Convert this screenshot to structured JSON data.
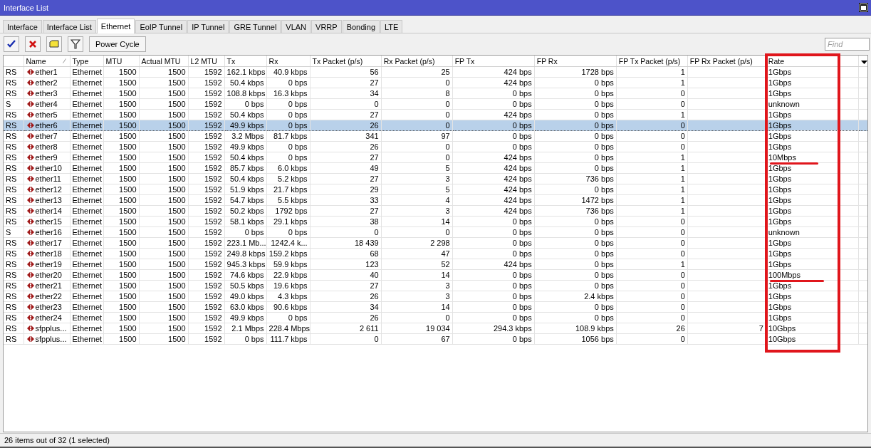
{
  "window": {
    "title": "Interface List"
  },
  "tabs": [
    {
      "label": "Interface",
      "selected": false
    },
    {
      "label": "Interface List",
      "selected": false
    },
    {
      "label": "Ethernet",
      "selected": true
    },
    {
      "label": "EoIP Tunnel",
      "selected": false
    },
    {
      "label": "IP Tunnel",
      "selected": false
    },
    {
      "label": "GRE Tunnel",
      "selected": false
    },
    {
      "label": "VLAN",
      "selected": false
    },
    {
      "label": "VRRP",
      "selected": false
    },
    {
      "label": "Bonding",
      "selected": false
    },
    {
      "label": "LTE",
      "selected": false
    }
  ],
  "toolbar": {
    "tools": [
      {
        "kind": "enable"
      },
      {
        "kind": "disable"
      },
      {
        "kind": "comment"
      },
      {
        "kind": "filter"
      }
    ],
    "button": "Power Cycle",
    "search": {
      "placeholder": "Find"
    }
  },
  "table": {
    "columns": [
      {
        "kind": "text"
      },
      {
        "label": "Name",
        "kind": "text",
        "sorted": true
      },
      {
        "label": "Type",
        "kind": "text"
      },
      {
        "label": "MTU",
        "kind": "number"
      },
      {
        "label": "Actual MTU",
        "kind": "number"
      },
      {
        "label": "L2 MTU",
        "kind": "number"
      },
      {
        "label": "Tx",
        "kind": "number"
      },
      {
        "label": "Rx",
        "kind": "number"
      },
      {
        "label": "Tx Packet (p/s)",
        "kind": "number"
      },
      {
        "label": "Rx Packet (p/s)",
        "kind": "number"
      },
      {
        "label": "FP Tx",
        "kind": "number"
      },
      {
        "label": "FP Rx",
        "kind": "number"
      },
      {
        "label": "FP Tx Packet (p/s)",
        "kind": "number"
      },
      {
        "label": "FP Rx Packet (p/s)",
        "kind": "number"
      },
      {
        "label": "Rate",
        "kind": "text",
        "highlighted": true
      }
    ],
    "rows": [
      {
        "selected": false,
        "underlined": false,
        "cells": [
          "RS",
          "ether1",
          "Ethernet",
          "1500",
          "1500",
          "1592",
          "162.1 kbps",
          "40.9 kbps",
          "56",
          "25",
          "424 bps",
          "1728 bps",
          "1",
          "",
          "1Gbps"
        ]
      },
      {
        "selected": false,
        "underlined": false,
        "cells": [
          "RS",
          "ether2",
          "Ethernet",
          "1500",
          "1500",
          "1592",
          "50.4 kbps",
          "0 bps",
          "27",
          "0",
          "424 bps",
          "0 bps",
          "1",
          "",
          "1Gbps"
        ]
      },
      {
        "selected": false,
        "underlined": false,
        "cells": [
          "RS",
          "ether3",
          "Ethernet",
          "1500",
          "1500",
          "1592",
          "108.8 kbps",
          "16.3 kbps",
          "34",
          "8",
          "0 bps",
          "0 bps",
          "0",
          "",
          "1Gbps"
        ]
      },
      {
        "selected": false,
        "underlined": false,
        "cells": [
          "S",
          "ether4",
          "Ethernet",
          "1500",
          "1500",
          "1592",
          "0 bps",
          "0 bps",
          "0",
          "0",
          "0 bps",
          "0 bps",
          "0",
          "",
          "unknown"
        ]
      },
      {
        "selected": false,
        "underlined": false,
        "cells": [
          "RS",
          "ether5",
          "Ethernet",
          "1500",
          "1500",
          "1592",
          "50.4 kbps",
          "0 bps",
          "27",
          "0",
          "424 bps",
          "0 bps",
          "1",
          "",
          "1Gbps"
        ]
      },
      {
        "selected": true,
        "underlined": false,
        "cells": [
          "RS",
          "ether6",
          "Ethernet",
          "1500",
          "1500",
          "1592",
          "49.9 kbps",
          "0 bps",
          "26",
          "0",
          "0 bps",
          "0 bps",
          "0",
          "",
          "1Gbps"
        ]
      },
      {
        "selected": false,
        "underlined": false,
        "cells": [
          "RS",
          "ether7",
          "Ethernet",
          "1500",
          "1500",
          "1592",
          "3.2 Mbps",
          "81.7 kbps",
          "341",
          "97",
          "0 bps",
          "0 bps",
          "0",
          "",
          "1Gbps"
        ]
      },
      {
        "selected": false,
        "underlined": false,
        "cells": [
          "RS",
          "ether8",
          "Ethernet",
          "1500",
          "1500",
          "1592",
          "49.9 kbps",
          "0 bps",
          "26",
          "0",
          "0 bps",
          "0 bps",
          "0",
          "",
          "1Gbps"
        ]
      },
      {
        "selected": false,
        "underlined": true,
        "cells": [
          "RS",
          "ether9",
          "Ethernet",
          "1500",
          "1500",
          "1592",
          "50.4 kbps",
          "0 bps",
          "27",
          "0",
          "424 bps",
          "0 bps",
          "1",
          "",
          "10Mbps"
        ]
      },
      {
        "selected": false,
        "underlined": false,
        "cells": [
          "RS",
          "ether10",
          "Ethernet",
          "1500",
          "1500",
          "1592",
          "85.7 kbps",
          "6.0 kbps",
          "49",
          "5",
          "424 bps",
          "0 bps",
          "1",
          "",
          "1Gbps"
        ]
      },
      {
        "selected": false,
        "underlined": false,
        "cells": [
          "RS",
          "ether11",
          "Ethernet",
          "1500",
          "1500",
          "1592",
          "50.4 kbps",
          "5.2 kbps",
          "27",
          "3",
          "424 bps",
          "736 bps",
          "1",
          "",
          "1Gbps"
        ]
      },
      {
        "selected": false,
        "underlined": false,
        "cells": [
          "RS",
          "ether12",
          "Ethernet",
          "1500",
          "1500",
          "1592",
          "51.9 kbps",
          "21.7 kbps",
          "29",
          "5",
          "424 bps",
          "0 bps",
          "1",
          "",
          "1Gbps"
        ]
      },
      {
        "selected": false,
        "underlined": false,
        "cells": [
          "RS",
          "ether13",
          "Ethernet",
          "1500",
          "1500",
          "1592",
          "54.7 kbps",
          "5.5 kbps",
          "33",
          "4",
          "424 bps",
          "1472 bps",
          "1",
          "",
          "1Gbps"
        ]
      },
      {
        "selected": false,
        "underlined": false,
        "cells": [
          "RS",
          "ether14",
          "Ethernet",
          "1500",
          "1500",
          "1592",
          "50.2 kbps",
          "1792 bps",
          "27",
          "3",
          "424 bps",
          "736 bps",
          "1",
          "",
          "1Gbps"
        ]
      },
      {
        "selected": false,
        "underlined": false,
        "cells": [
          "RS",
          "ether15",
          "Ethernet",
          "1500",
          "1500",
          "1592",
          "58.1 kbps",
          "29.1 kbps",
          "38",
          "14",
          "0 bps",
          "0 bps",
          "0",
          "",
          "1Gbps"
        ]
      },
      {
        "selected": false,
        "underlined": false,
        "cells": [
          "S",
          "ether16",
          "Ethernet",
          "1500",
          "1500",
          "1592",
          "0 bps",
          "0 bps",
          "0",
          "0",
          "0 bps",
          "0 bps",
          "0",
          "",
          "unknown"
        ]
      },
      {
        "selected": false,
        "underlined": false,
        "cells": [
          "RS",
          "ether17",
          "Ethernet",
          "1500",
          "1500",
          "1592",
          "223.1 Mb...",
          "1242.4 k...",
          "18 439",
          "2 298",
          "0 bps",
          "0 bps",
          "0",
          "",
          "1Gbps"
        ]
      },
      {
        "selected": false,
        "underlined": false,
        "cells": [
          "RS",
          "ether18",
          "Ethernet",
          "1500",
          "1500",
          "1592",
          "249.8 kbps",
          "159.2 kbps",
          "68",
          "47",
          "0 bps",
          "0 bps",
          "0",
          "",
          "1Gbps"
        ]
      },
      {
        "selected": false,
        "underlined": false,
        "cells": [
          "RS",
          "ether19",
          "Ethernet",
          "1500",
          "1500",
          "1592",
          "945.3 kbps",
          "59.9 kbps",
          "123",
          "52",
          "424 bps",
          "0 bps",
          "1",
          "",
          "1Gbps"
        ]
      },
      {
        "selected": false,
        "underlined": true,
        "cells": [
          "RS",
          "ether20",
          "Ethernet",
          "1500",
          "1500",
          "1592",
          "74.6 kbps",
          "22.9 kbps",
          "40",
          "14",
          "0 bps",
          "0 bps",
          "0",
          "",
          "100Mbps"
        ]
      },
      {
        "selected": false,
        "underlined": false,
        "cells": [
          "RS",
          "ether21",
          "Ethernet",
          "1500",
          "1500",
          "1592",
          "50.5 kbps",
          "19.6 kbps",
          "27",
          "3",
          "0 bps",
          "0 bps",
          "0",
          "",
          "1Gbps"
        ]
      },
      {
        "selected": false,
        "underlined": false,
        "cells": [
          "RS",
          "ether22",
          "Ethernet",
          "1500",
          "1500",
          "1592",
          "49.0 kbps",
          "4.3 kbps",
          "26",
          "3",
          "0 bps",
          "2.4 kbps",
          "0",
          "",
          "1Gbps"
        ]
      },
      {
        "selected": false,
        "underlined": false,
        "cells": [
          "RS",
          "ether23",
          "Ethernet",
          "1500",
          "1500",
          "1592",
          "63.0 kbps",
          "90.6 kbps",
          "34",
          "14",
          "0 bps",
          "0 bps",
          "0",
          "",
          "1Gbps"
        ]
      },
      {
        "selected": false,
        "underlined": false,
        "cells": [
          "RS",
          "ether24",
          "Ethernet",
          "1500",
          "1500",
          "1592",
          "49.9 kbps",
          "0 bps",
          "26",
          "0",
          "0 bps",
          "0 bps",
          "0",
          "",
          "1Gbps"
        ]
      },
      {
        "selected": false,
        "underlined": false,
        "cells": [
          "RS",
          "sfpplus...",
          "Ethernet",
          "1500",
          "1500",
          "1592",
          "2.1 Mbps",
          "228.4 Mbps",
          "2 611",
          "19 034",
          "294.3 kbps",
          "108.9 kbps",
          "26",
          "7",
          "10Gbps"
        ]
      },
      {
        "selected": false,
        "underlined": false,
        "cells": [
          "RS",
          "sfpplus...",
          "Ethernet",
          "1500",
          "1500",
          "1592",
          "0 bps",
          "111.7 kbps",
          "0",
          "67",
          "0 bps",
          "1056 bps",
          "0",
          "",
          "10Gbps"
        ]
      }
    ]
  },
  "status_bar": "26 items out of 32 (1 selected)"
}
